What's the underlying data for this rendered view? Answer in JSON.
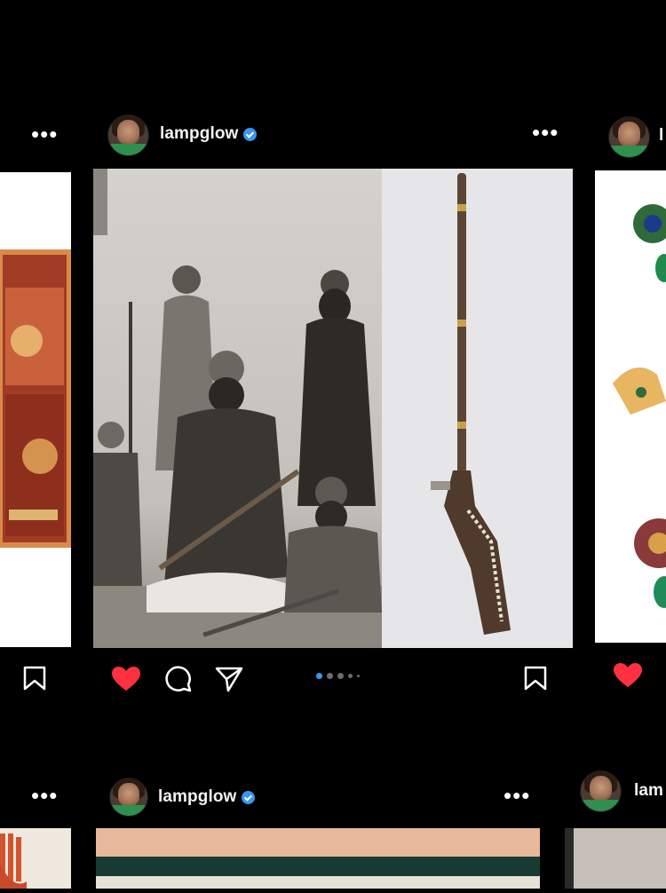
{
  "posts": {
    "center_top": {
      "username": "lampglow",
      "more_label": "•••",
      "carousel_current": 1,
      "carousel_total": 5,
      "liked": true,
      "photo_left": "sepia group portrait of seated and standing men in turbans with rifles",
      "photo_right": "inlaid long-barrel flintlock gun on white background"
    },
    "right_top": {
      "username_partial": "l"
    },
    "left_top": {
      "more_label": "•••"
    },
    "center_bottom": {
      "username": "lampglow",
      "more_label": "•••"
    },
    "right_bottom": {
      "username_partial": "lam"
    },
    "left_bottom": {
      "more_label": "•••"
    }
  },
  "colors": {
    "background": "#000000",
    "like_red": "#ff3040",
    "verified_blue": "#3897f0",
    "carousel_active": "#3897f0"
  },
  "icons": [
    "heart-icon",
    "comment-icon",
    "share-icon",
    "bookmark-icon",
    "verified-badge-icon",
    "more-options-icon"
  ]
}
